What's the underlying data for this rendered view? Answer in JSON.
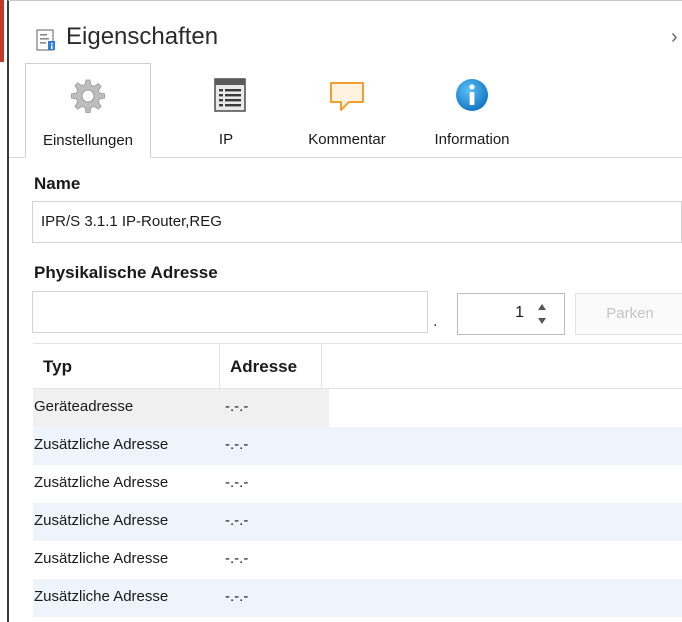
{
  "panel": {
    "title": "Eigenschaften",
    "collapse_glyph": "›"
  },
  "tabs": [
    {
      "label": "Einstellungen",
      "icon": "gear-icon",
      "active": true
    },
    {
      "label": "IP",
      "icon": "list-document-icon",
      "active": false
    },
    {
      "label": "Kommentar",
      "icon": "comment-icon",
      "active": false
    },
    {
      "label": "Information",
      "icon": "info-icon",
      "active": false
    }
  ],
  "name_section": {
    "label": "Name",
    "value": "IPR/S 3.1.1 IP-Router,REG"
  },
  "address_section": {
    "label": "Physikalische Adresse",
    "area_value": "",
    "separator": ".",
    "device_number": "1",
    "park_button": "Parken"
  },
  "address_table": {
    "headers": [
      "Typ",
      "Adresse"
    ],
    "rows": [
      {
        "type": "Geräteadresse",
        "address": "-.-.-"
      },
      {
        "type": "Zusätzliche Adresse",
        "address": "-.-.-"
      },
      {
        "type": "Zusätzliche Adresse",
        "address": "-.-.-"
      },
      {
        "type": "Zusätzliche Adresse",
        "address": "-.-.-"
      },
      {
        "type": "Zusätzliche Adresse",
        "address": "-.-.-"
      },
      {
        "type": "Zusätzliche Adresse",
        "address": "-.-.-"
      }
    ]
  },
  "colors": {
    "accent_red": "#c0392b",
    "info_blue": "#1c8fd8",
    "comment_orange": "#f0a030",
    "row_alt": "#eef4fb"
  }
}
